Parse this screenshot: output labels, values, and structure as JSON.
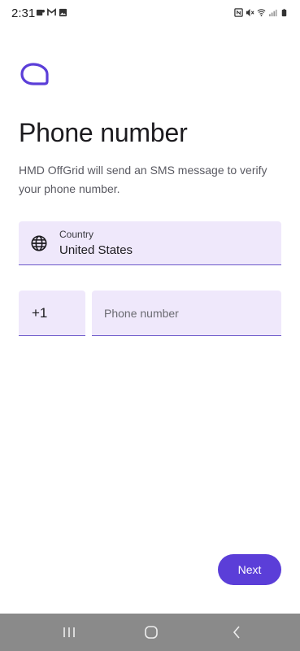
{
  "status_bar": {
    "time": "2:31",
    "left_icons": [
      "teams-icon",
      "gmail-icon",
      "gallery-icon"
    ],
    "right_icons": [
      "nfc-icon",
      "mute-icon",
      "wifi-icon",
      "signal-icon",
      "battery-icon"
    ]
  },
  "app": {
    "logo_icon": "chat-bubble-icon",
    "accent_color": "#5b3ed8",
    "field_background": "#efe8fb"
  },
  "header": {
    "title": "Phone number",
    "description": "HMD OffGrid will send an SMS message to verify your phone number."
  },
  "country": {
    "label": "Country",
    "value": "United States",
    "icon": "globe-icon"
  },
  "phone": {
    "country_code": "+1",
    "placeholder": "Phone number",
    "value": ""
  },
  "actions": {
    "next_label": "Next"
  },
  "nav_bar": {
    "buttons": [
      "recent-apps-icon",
      "home-icon",
      "back-icon"
    ]
  }
}
